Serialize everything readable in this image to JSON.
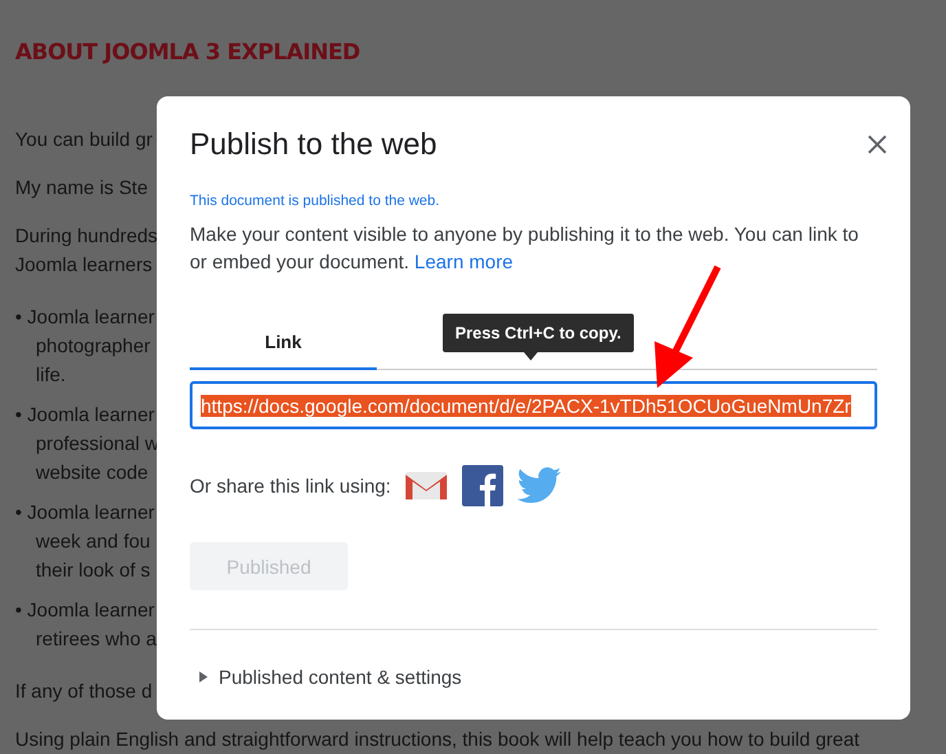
{
  "background_page": {
    "heading": "ABOUT JOOMLA 3 EXPLAINED",
    "paragraphs": [
      {
        "kind": "text",
        "lines": [
          "You can build gr"
        ]
      },
      {
        "kind": "text",
        "lines": [
          "My name is Ste"
        ]
      },
      {
        "kind": "text",
        "lines": [
          "During hundreds",
          "Joomla learners"
        ]
      },
      {
        "kind": "bullet",
        "lines": [
          "• Joomla learner",
          "photographer",
          "life."
        ]
      },
      {
        "kind": "bullet",
        "lines": [
          "• Joomla learner",
          "professional w",
          "website code"
        ]
      },
      {
        "kind": "bullet",
        "lines": [
          "• Joomla learner",
          "week and fou",
          "their look of s"
        ]
      },
      {
        "kind": "bullet",
        "lines": [
          "• Joomla learner",
          "retirees who a"
        ]
      },
      {
        "kind": "text",
        "lines": [
          "If any of those d"
        ]
      },
      {
        "kind": "text",
        "lines": [
          "Using plain English and straightforward instructions, this book will help teach you how to build great"
        ]
      }
    ]
  },
  "dialog": {
    "title": "Publish to the web",
    "status": "This document is published to the web.",
    "description": "Make your content visible to anyone by publishing it to the web. You can link to or embed your document.",
    "learn_more": "Learn more",
    "tabs": [
      {
        "label": "Link",
        "selected": true
      }
    ],
    "tooltip": "Press Ctrl+C to copy.",
    "link_field": {
      "value": "https://docs.google.com/document/d/e/2PACX-1vTDh51OCUoGueNmUn7Zr",
      "selected": true
    },
    "share_label": "Or share this link using:",
    "published_button": {
      "label": "Published",
      "disabled": true
    },
    "settings_toggle": {
      "label": "Published content & settings",
      "expanded": false
    }
  }
}
